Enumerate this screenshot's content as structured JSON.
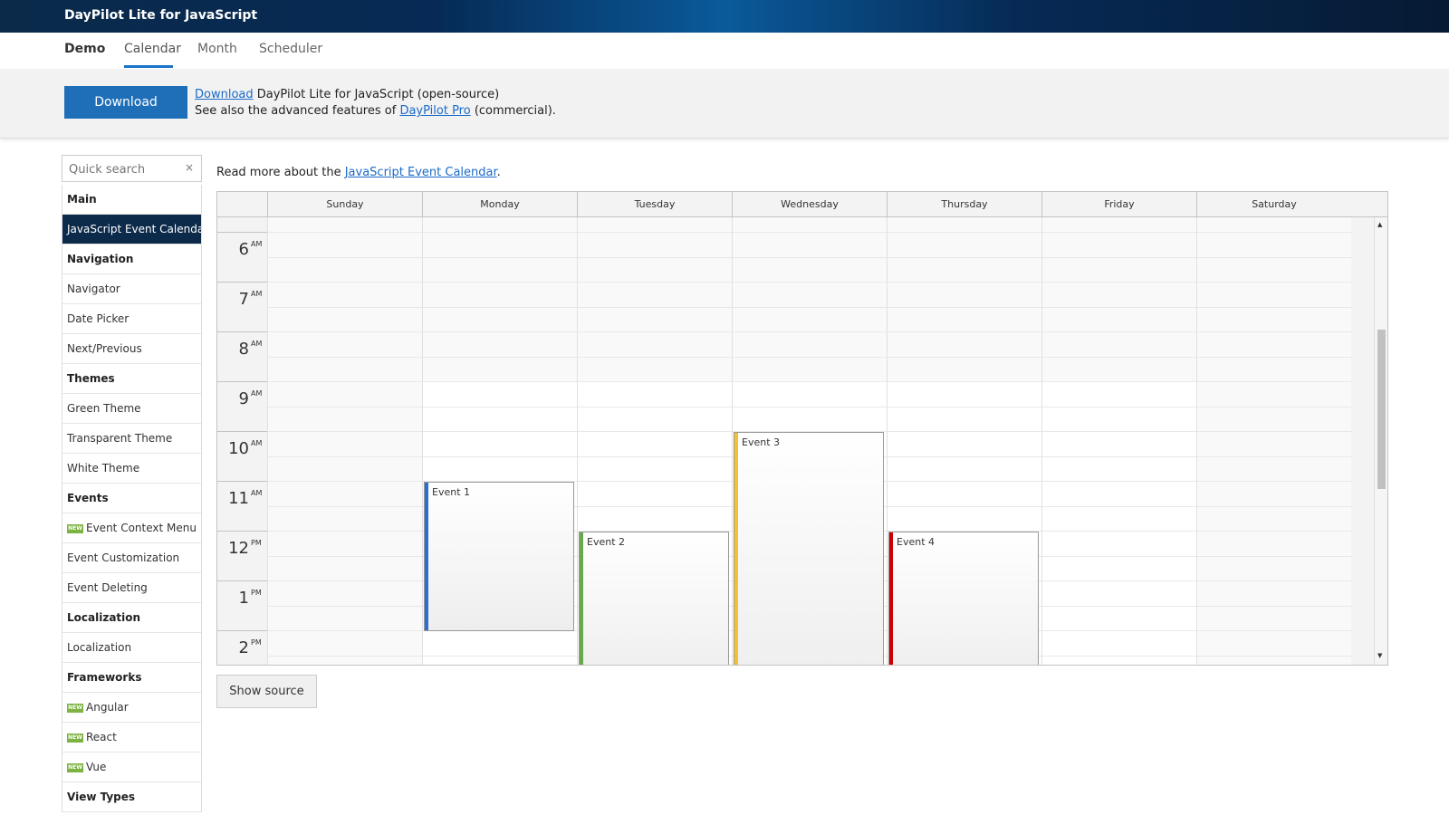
{
  "app": {
    "title": "DayPilot Lite for JavaScript"
  },
  "tabs": [
    {
      "label": "Demo"
    },
    {
      "label": "Calendar"
    },
    {
      "label": "Month"
    },
    {
      "label": "Scheduler"
    }
  ],
  "banner": {
    "download_button": "Download",
    "line1_link": "Download",
    "line1_text": " DayPilot Lite for JavaScript (open-source)",
    "line2_prefix": "See also the advanced features of ",
    "line2_link": "DayPilot Pro",
    "line2_suffix": " (commercial)."
  },
  "search": {
    "placeholder": "Quick search",
    "clear_icon": "×"
  },
  "sidebar": {
    "items": [
      {
        "label": "Main",
        "type": "header"
      },
      {
        "label": "JavaScript Event Calendar",
        "type": "item",
        "selected": true
      },
      {
        "label": "Navigation",
        "type": "header"
      },
      {
        "label": "Navigator",
        "type": "item"
      },
      {
        "label": "Date Picker",
        "type": "item"
      },
      {
        "label": "Next/Previous",
        "type": "item"
      },
      {
        "label": "Themes",
        "type": "header"
      },
      {
        "label": "Green Theme",
        "type": "item"
      },
      {
        "label": "Transparent Theme",
        "type": "item"
      },
      {
        "label": "White Theme",
        "type": "item"
      },
      {
        "label": "Events",
        "type": "header"
      },
      {
        "label": "Event Context Menu",
        "type": "item",
        "badge": "NEW"
      },
      {
        "label": "Event Customization",
        "type": "item"
      },
      {
        "label": "Event Deleting",
        "type": "item"
      },
      {
        "label": "Localization",
        "type": "header"
      },
      {
        "label": "Localization",
        "type": "item"
      },
      {
        "label": "Frameworks",
        "type": "header"
      },
      {
        "label": "Angular",
        "type": "item",
        "badge": "NEW"
      },
      {
        "label": "React",
        "type": "item",
        "badge": "NEW"
      },
      {
        "label": "Vue",
        "type": "item",
        "badge": "NEW"
      },
      {
        "label": "View Types",
        "type": "header"
      }
    ]
  },
  "readmore": {
    "prefix": "Read more about the ",
    "link": "JavaScript Event Calendar",
    "suffix": "."
  },
  "calendar": {
    "days": [
      "Sunday",
      "Monday",
      "Tuesday",
      "Wednesday",
      "Thursday",
      "Friday",
      "Saturday"
    ],
    "hours": [
      {
        "num": "6",
        "ampm": "AM"
      },
      {
        "num": "7",
        "ampm": "AM"
      },
      {
        "num": "8",
        "ampm": "AM"
      },
      {
        "num": "9",
        "ampm": "AM"
      },
      {
        "num": "10",
        "ampm": "AM"
      },
      {
        "num": "11",
        "ampm": "AM"
      },
      {
        "num": "12",
        "ampm": "PM"
      },
      {
        "num": "1",
        "ampm": "PM"
      },
      {
        "num": "2",
        "ampm": "PM"
      }
    ],
    "events": [
      {
        "text": "Event 1",
        "day": 1,
        "color": "#2e6ed0"
      },
      {
        "text": "Event 2",
        "day": 2,
        "color": "#6aa84f"
      },
      {
        "text": "Event 3",
        "day": 3,
        "color": "#f1c232"
      },
      {
        "text": "Event 4",
        "day": 4,
        "color": "#cc0000"
      }
    ]
  },
  "show_source": "Show source",
  "colors": {
    "accent": "#1e6fb8",
    "header_dark": "#0c2a4a"
  }
}
